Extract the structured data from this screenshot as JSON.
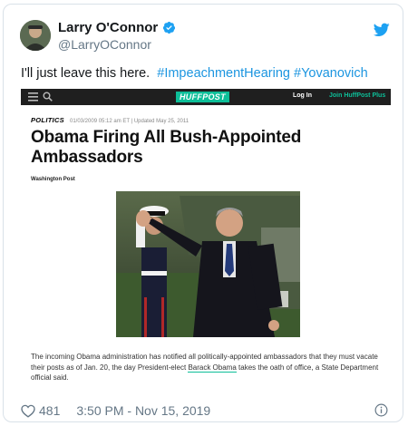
{
  "tweet": {
    "author_name": "Larry O'Connor",
    "handle": "@LarryOConnor",
    "text_plain": "I'll just leave this here.",
    "hashtags": [
      "#ImpeachmentHearing",
      "#Yovanovich"
    ],
    "likes": "481",
    "timestamp": "3:50 PM - Nov 15, 2019"
  },
  "embed": {
    "site_logo": "HUFFPOST",
    "login_label": "Log In",
    "join_label": "Join HuffPost Plus",
    "section": "POLITICS",
    "dates": "01/03/2009 05:12 am ET | Updated May 25, 2011",
    "headline": "Obama Firing All Bush-Appointed Ambassadors",
    "source": "Washington Post",
    "body_1": "The incoming Obama administration has notified all politically-appointed ambassadors that they must vacate their posts as of Jan. 20, the day President-elect ",
    "body_link": "Barack Obama",
    "body_2": " takes the oath of office, a State Department official said."
  },
  "colors": {
    "accent": "#1b95e0",
    "huffpost_green": "#0dbe98",
    "text": "#14171a",
    "muted": "#657786"
  }
}
